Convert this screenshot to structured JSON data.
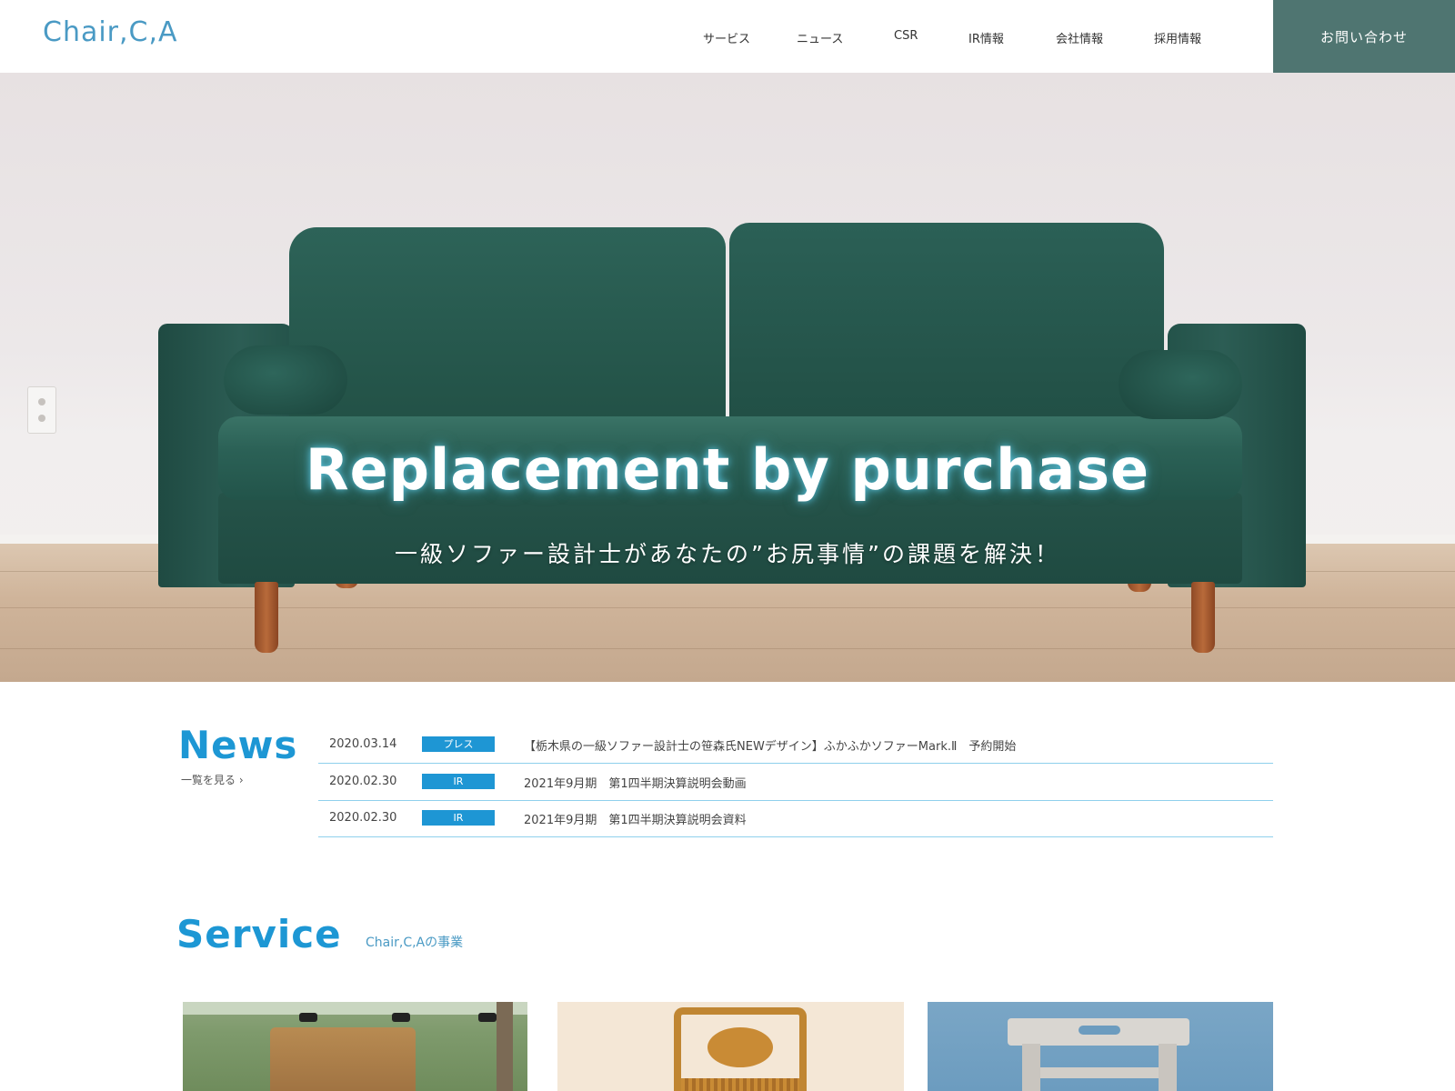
{
  "header": {
    "logo": "Chair,C,A",
    "nav": [
      "サービス",
      "ニュース",
      "CSR",
      "IR情報",
      "会社情報",
      "採用情報"
    ],
    "contact_label": "お問い合わせ"
  },
  "hero": {
    "title": "Replacement by purchase",
    "subtitle": "一級ソファー設計士があなたの”お尻事情”の課題を解決！"
  },
  "news": {
    "title": "News",
    "more_label": "一覧を見る ›",
    "items": [
      {
        "date": "2020.03.14",
        "category": "プレス",
        "text": "【栃木県の一級ソファー設計士の笹森氏NEWデザイン】ふかふかソファーMark.Ⅱ　予約開始"
      },
      {
        "date": "2020.02.30",
        "category": "IR",
        "text": "2021年9月期　第1四半期決算説明会動画"
      },
      {
        "date": "2020.02.30",
        "category": "IR",
        "text": "2021年9月期　第1四半期決算説明会資料"
      }
    ]
  },
  "service": {
    "title": "Service",
    "subtitle": "Chair,C,Aの事業"
  },
  "colors": {
    "accent": "#1d97d4",
    "logo": "#4a9ac4",
    "contact_bg": "#4f7571",
    "badge": "#1e96d4",
    "divider": "#8fd0ec"
  }
}
